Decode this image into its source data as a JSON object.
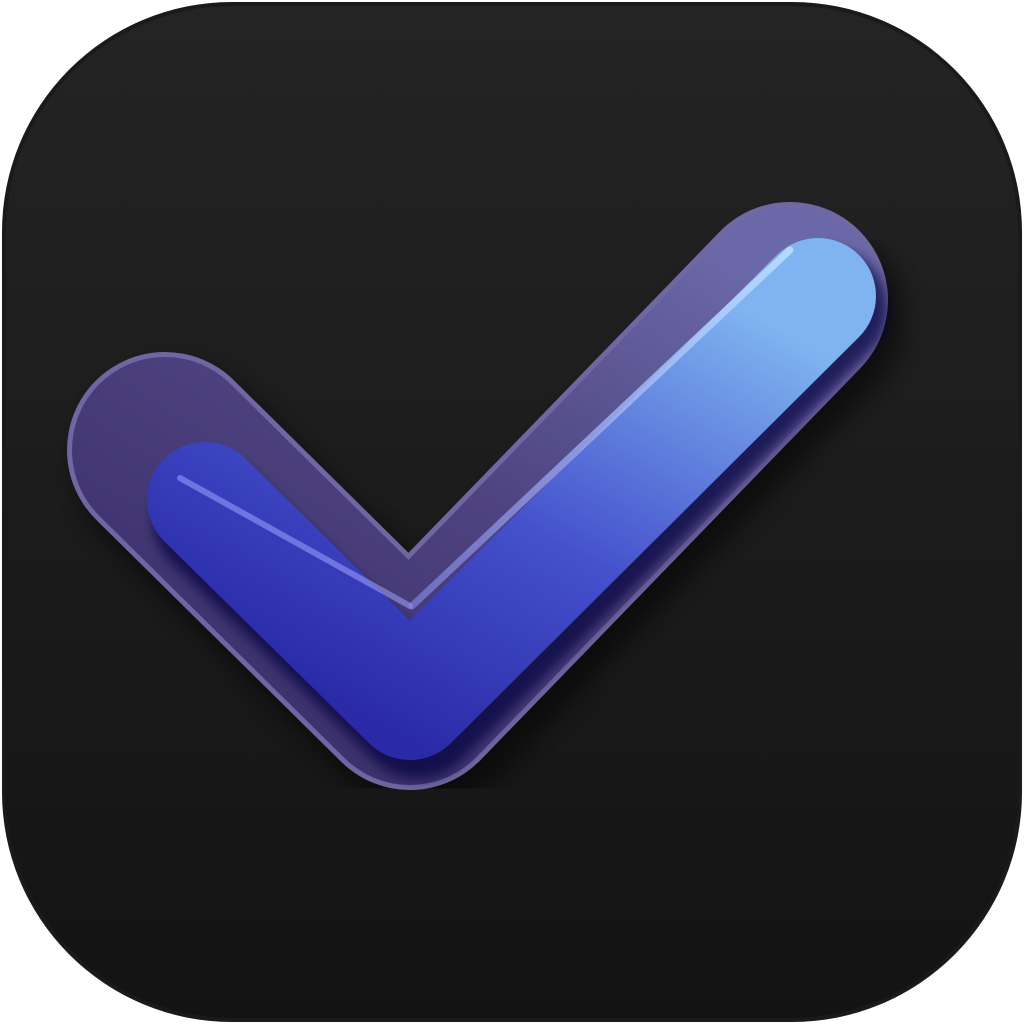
{
  "app_icon": {
    "name": "checkmark-app-icon",
    "glyph": "checkmark-icon",
    "colors": {
      "background_top": "#232323",
      "background_bottom": "#141414",
      "outer_ring": "#5b4f8c",
      "outer_ring_edge": "#7a6fb0",
      "check_dark": "#2e2fae",
      "check_mid": "#4a55d0",
      "check_light": "#7fb0ee",
      "highlight": "#a8d0ff"
    }
  }
}
